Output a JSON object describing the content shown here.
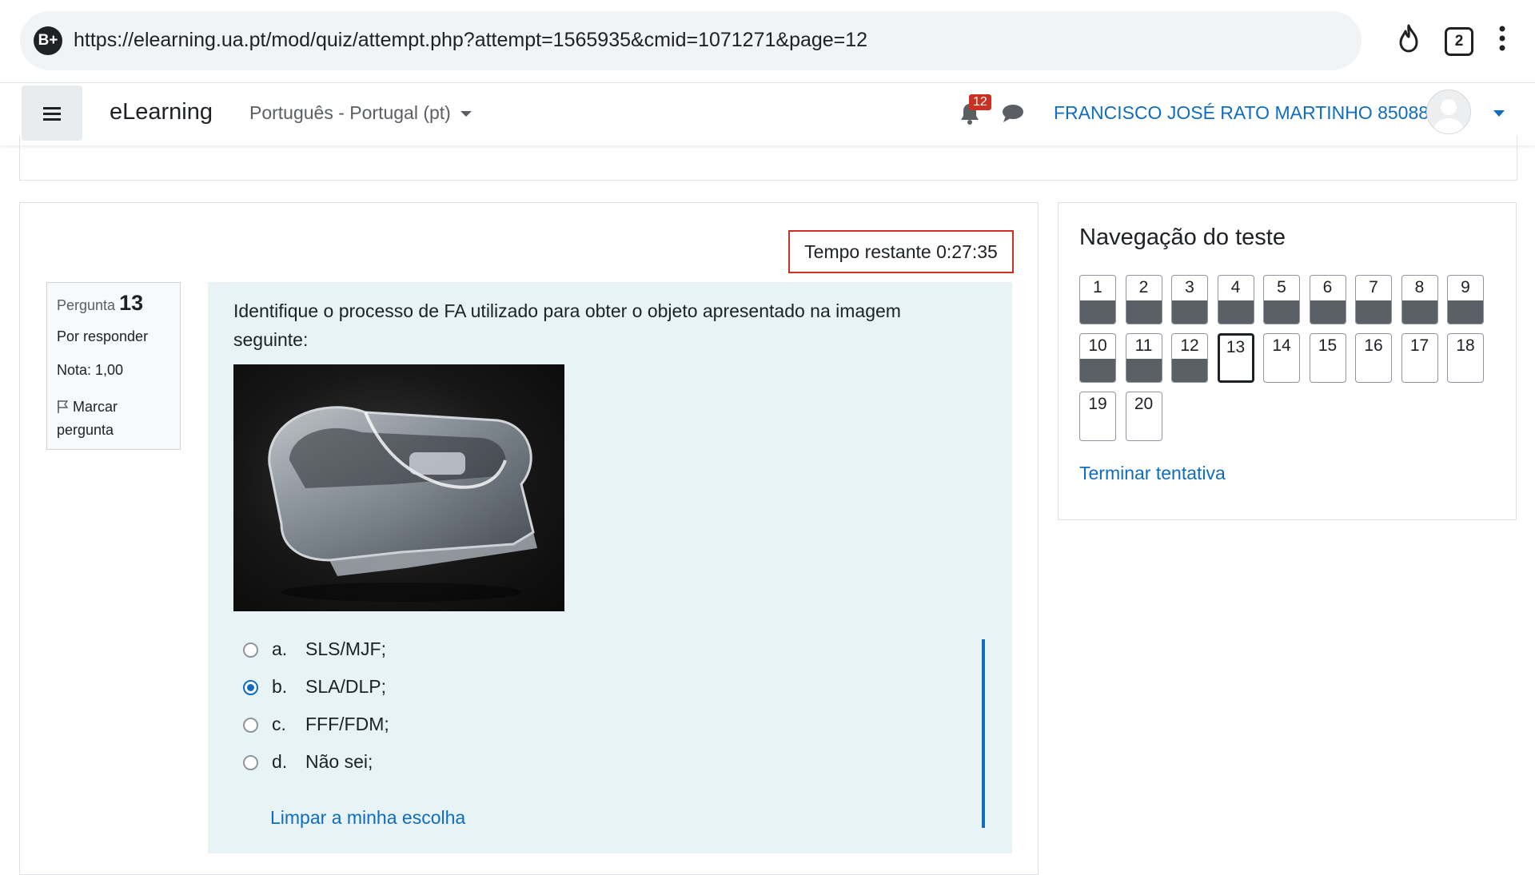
{
  "browser": {
    "site_badge": "B+",
    "url": "https://elearning.ua.pt/mod/quiz/attempt.php?attempt=1565935&cmid=1071271&page=12",
    "tab_count": "2",
    "icons": [
      "flame-icon",
      "tab-switcher-icon",
      "kebab-menu-icon"
    ]
  },
  "navbar": {
    "brand": "eLearning",
    "language": "Português - Portugal (pt)",
    "notification_count": "12",
    "user_name": "FRANCISCO JOSÉ RATO MARTINHO 85088",
    "icons": [
      "hamburger-icon",
      "bell-icon",
      "chat-icon",
      "avatar",
      "chevron-down-icon"
    ]
  },
  "quiz": {
    "timer_label": "Tempo restante 0:27:35",
    "question_info": {
      "label": "Pergunta",
      "number": "13",
      "state": "Por responder",
      "grade": "Nota: 1,00",
      "flag": "Marcar pergunta"
    },
    "question_text": "Identifique o processo de FA utilizado para obter o objeto apresentado na imagem seguinte:",
    "image_description_icon": "transparent-plastic-clip-image",
    "answers": [
      {
        "letter": "a.",
        "text": "SLS/MJF;",
        "selected": false
      },
      {
        "letter": "b.",
        "text": "SLA/DLP;",
        "selected": true
      },
      {
        "letter": "c.",
        "text": "FFF/FDM;",
        "selected": false
      },
      {
        "letter": "d.",
        "text": "Não sei;",
        "selected": false
      }
    ],
    "clear_choice": "Limpar a minha escolha"
  },
  "navigation": {
    "title": "Navegação do teste",
    "buttons": [
      {
        "n": "1",
        "answered": true
      },
      {
        "n": "2",
        "answered": true
      },
      {
        "n": "3",
        "answered": true
      },
      {
        "n": "4",
        "answered": true
      },
      {
        "n": "5",
        "answered": true
      },
      {
        "n": "6",
        "answered": true
      },
      {
        "n": "7",
        "answered": true
      },
      {
        "n": "8",
        "answered": true
      },
      {
        "n": "9",
        "answered": true
      },
      {
        "n": "10",
        "answered": true
      },
      {
        "n": "11",
        "answered": true
      },
      {
        "n": "12",
        "answered": true
      },
      {
        "n": "13",
        "answered": false,
        "current": true
      },
      {
        "n": "14",
        "answered": false
      },
      {
        "n": "15",
        "answered": false
      },
      {
        "n": "16",
        "answered": false
      },
      {
        "n": "17",
        "answered": false
      },
      {
        "n": "18",
        "answered": false
      },
      {
        "n": "19",
        "answered": false
      },
      {
        "n": "20",
        "answered": false
      }
    ],
    "finish_link": "Terminar tentativa"
  },
  "colors": {
    "accent_blue": "#0f6cbf",
    "timer_border": "#ca3120",
    "question_bg": "#e7f3f5",
    "answered_fill": "#5b6066"
  }
}
